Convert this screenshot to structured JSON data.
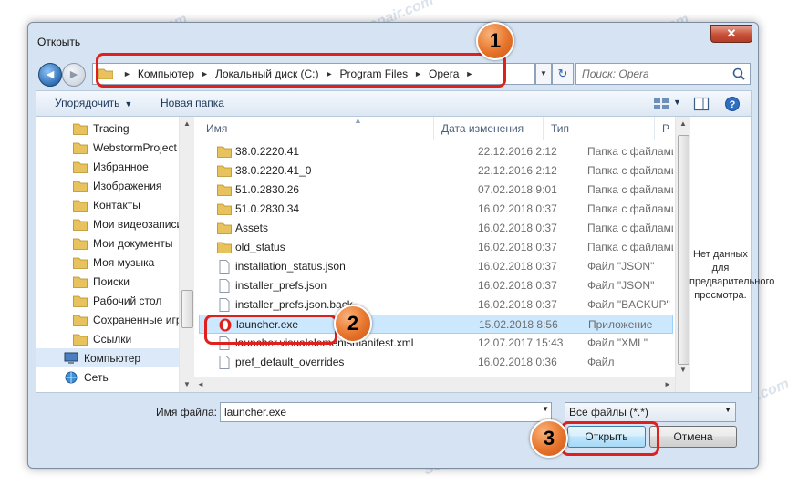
{
  "window": {
    "title": "Открыть",
    "close_glyph": "✕"
  },
  "nav": {
    "back_glyph": "◄",
    "fwd_glyph": "►",
    "breadcrumbs": [
      "Компьютер",
      "Локальный диск (C:)",
      "Program Files",
      "Opera"
    ],
    "crumb_sep": "►",
    "dropdown_glyph": "▼",
    "refresh_glyph": "↻",
    "search_placeholder": "Поиск: Opera"
  },
  "toolbar": {
    "organize_label": "Упорядочить",
    "caret": "▼",
    "new_folder_label": "Новая папка"
  },
  "sidebar": {
    "items": [
      {
        "label": "Tracing",
        "icon": "folder-icon"
      },
      {
        "label": "WebstormProject",
        "icon": "folder-icon"
      },
      {
        "label": "Избранное",
        "icon": "folder-icon"
      },
      {
        "label": "Изображения",
        "icon": "folder-icon"
      },
      {
        "label": "Контакты",
        "icon": "folder-icon"
      },
      {
        "label": "Мои видеозаписи",
        "icon": "folder-icon"
      },
      {
        "label": "Мои документы",
        "icon": "folder-icon"
      },
      {
        "label": "Моя музыка",
        "icon": "folder-icon"
      },
      {
        "label": "Поиски",
        "icon": "folder-icon"
      },
      {
        "label": "Рабочий стол",
        "icon": "folder-icon"
      },
      {
        "label": "Сохраненные игр",
        "icon": "folder-icon"
      },
      {
        "label": "Ссылки",
        "icon": "folder-icon"
      },
      {
        "label": "Компьютер",
        "icon": "computer-icon"
      },
      {
        "label": "Сеть",
        "icon": "network-icon"
      }
    ]
  },
  "columns": {
    "name": "Имя",
    "date": "Дата изменения",
    "type": "Тип",
    "size": "Р"
  },
  "files": [
    {
      "name": "38.0.2220.41",
      "date": "22.12.2016 2:12",
      "type": "Папка с файлами",
      "icon": "folder-icon"
    },
    {
      "name": "38.0.2220.41_0",
      "date": "22.12.2016 2:12",
      "type": "Папка с файлами",
      "icon": "folder-icon"
    },
    {
      "name": "51.0.2830.26",
      "date": "07.02.2018 9:01",
      "type": "Папка с файлами",
      "icon": "folder-icon"
    },
    {
      "name": "51.0.2830.34",
      "date": "16.02.2018 0:37",
      "type": "Папка с файлами",
      "icon": "folder-icon"
    },
    {
      "name": "Assets",
      "date": "16.02.2018 0:37",
      "type": "Папка с файлами",
      "icon": "folder-icon"
    },
    {
      "name": "old_status",
      "date": "16.02.2018 0:37",
      "type": "Папка с файлами",
      "icon": "folder-icon"
    },
    {
      "name": "installation_status.json",
      "date": "16.02.2018 0:37",
      "type": "Файл \"JSON\"",
      "icon": "file-icon"
    },
    {
      "name": "installer_prefs.json",
      "date": "16.02.2018 0:37",
      "type": "Файл \"JSON\"",
      "icon": "file-icon"
    },
    {
      "name": "installer_prefs.json.back",
      "date": "16.02.2018 0:37",
      "type": "Файл \"BACKUP\"",
      "icon": "file-icon"
    },
    {
      "name": "launcher.exe",
      "date": "15.02.2018 8:56",
      "type": "Приложение",
      "icon": "opera-icon",
      "selected": true
    },
    {
      "name": "launcher.visualelementsmanifest.xml",
      "date": "12.07.2017 15:43",
      "type": "Файл \"XML\"",
      "icon": "file-icon"
    },
    {
      "name": "pref_default_overrides",
      "date": "16.02.2018 0:36",
      "type": "Файл",
      "icon": "file-icon"
    }
  ],
  "preview_text": "Нет данных для предварительного просмотра.",
  "filename": {
    "label": "Имя файла:",
    "value": "launcher.exe"
  },
  "filter": {
    "value": "Все файлы (*.*)"
  },
  "buttons": {
    "open": "Открыть",
    "cancel": "Отмена"
  },
  "badges": [
    "1",
    "2",
    "3"
  ],
  "watermark": "Soringpcrepair.com",
  "colors": {
    "highlight": "#e0201c",
    "badge": "#e7742b",
    "selection": "#cce8ff",
    "folder": "#e8c25c"
  }
}
